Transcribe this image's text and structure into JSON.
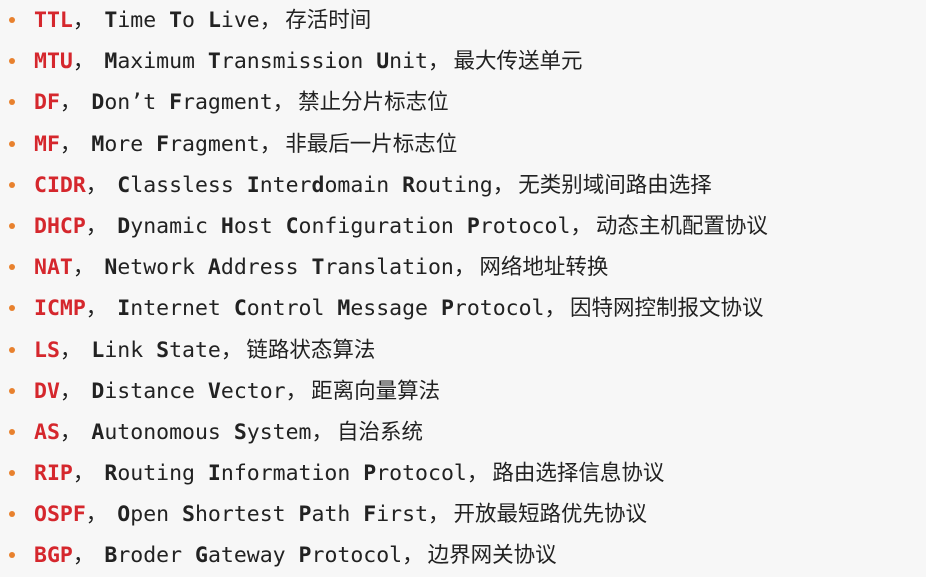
{
  "separator": "，",
  "items": [
    {
      "abbr": "TTL",
      "full": [
        [
          "T",
          1
        ],
        [
          "ime ",
          0
        ],
        [
          "T",
          1
        ],
        [
          "o ",
          0
        ],
        [
          "L",
          1
        ],
        [
          "ive",
          0
        ]
      ],
      "zh": "存活时间"
    },
    {
      "abbr": "MTU",
      "full": [
        [
          "M",
          1
        ],
        [
          "aximum ",
          0
        ],
        [
          "T",
          1
        ],
        [
          "ransmission ",
          0
        ],
        [
          "U",
          1
        ],
        [
          "nit",
          0
        ]
      ],
      "zh": "最大传送单元"
    },
    {
      "abbr": "DF",
      "full": [
        [
          "D",
          1
        ],
        [
          "on’t ",
          0
        ],
        [
          "F",
          1
        ],
        [
          "ragment",
          0
        ]
      ],
      "zh": "禁止分片标志位"
    },
    {
      "abbr": "MF",
      "full": [
        [
          "M",
          1
        ],
        [
          "ore ",
          0
        ],
        [
          "F",
          1
        ],
        [
          "ragment",
          0
        ]
      ],
      "zh": "非最后一片标志位"
    },
    {
      "abbr": "CIDR",
      "full": [
        [
          "C",
          1
        ],
        [
          "lassless ",
          0
        ],
        [
          "I",
          1
        ],
        [
          "nter",
          0
        ],
        [
          "d",
          1
        ],
        [
          "omain ",
          0
        ],
        [
          "R",
          1
        ],
        [
          "outing",
          0
        ]
      ],
      "zh": "无类别域间路由选择"
    },
    {
      "abbr": "DHCP",
      "full": [
        [
          "D",
          1
        ],
        [
          "ynamic ",
          0
        ],
        [
          "H",
          1
        ],
        [
          "ost ",
          0
        ],
        [
          "C",
          1
        ],
        [
          "onfiguration ",
          0
        ],
        [
          "P",
          1
        ],
        [
          "rotocol",
          0
        ]
      ],
      "zh": "动态主机配置协议"
    },
    {
      "abbr": "NAT",
      "full": [
        [
          "N",
          1
        ],
        [
          "etwork ",
          0
        ],
        [
          "A",
          1
        ],
        [
          "ddress ",
          0
        ],
        [
          "T",
          1
        ],
        [
          "ranslation",
          0
        ]
      ],
      "zh": "网络地址转换"
    },
    {
      "abbr": "ICMP",
      "full": [
        [
          "I",
          1
        ],
        [
          "nternet ",
          0
        ],
        [
          "C",
          1
        ],
        [
          "ontrol ",
          0
        ],
        [
          "M",
          1
        ],
        [
          "essage ",
          0
        ],
        [
          "P",
          1
        ],
        [
          "rotocol",
          0
        ]
      ],
      "zh": "因特网控制报文协议"
    },
    {
      "abbr": "LS",
      "full": [
        [
          "L",
          1
        ],
        [
          "ink ",
          0
        ],
        [
          "S",
          1
        ],
        [
          "tate",
          0
        ]
      ],
      "zh": "链路状态算法"
    },
    {
      "abbr": "DV",
      "full": [
        [
          "D",
          1
        ],
        [
          "istance ",
          0
        ],
        [
          "V",
          1
        ],
        [
          "ector",
          0
        ]
      ],
      "zh": "距离向量算法"
    },
    {
      "abbr": "AS",
      "full": [
        [
          "A",
          1
        ],
        [
          "utonomous ",
          0
        ],
        [
          "S",
          1
        ],
        [
          "ystem",
          0
        ]
      ],
      "zh": "自治系统"
    },
    {
      "abbr": "RIP",
      "full": [
        [
          "R",
          1
        ],
        [
          "outing ",
          0
        ],
        [
          "I",
          1
        ],
        [
          "nformation ",
          0
        ],
        [
          "P",
          1
        ],
        [
          "rotocol",
          0
        ]
      ],
      "zh": "路由选择信息协议"
    },
    {
      "abbr": "OSPF",
      "full": [
        [
          "O",
          1
        ],
        [
          "pen ",
          0
        ],
        [
          "S",
          1
        ],
        [
          "hortest ",
          0
        ],
        [
          "P",
          1
        ],
        [
          "ath ",
          0
        ],
        [
          "F",
          1
        ],
        [
          "irst",
          0
        ]
      ],
      "zh": "开放最短路优先协议"
    },
    {
      "abbr": "BGP",
      "full": [
        [
          "B",
          1
        ],
        [
          "roder ",
          0
        ],
        [
          "G",
          1
        ],
        [
          "ateway ",
          0
        ],
        [
          "P",
          1
        ],
        [
          "rotocol",
          0
        ]
      ],
      "zh": "边界网关协议"
    }
  ]
}
